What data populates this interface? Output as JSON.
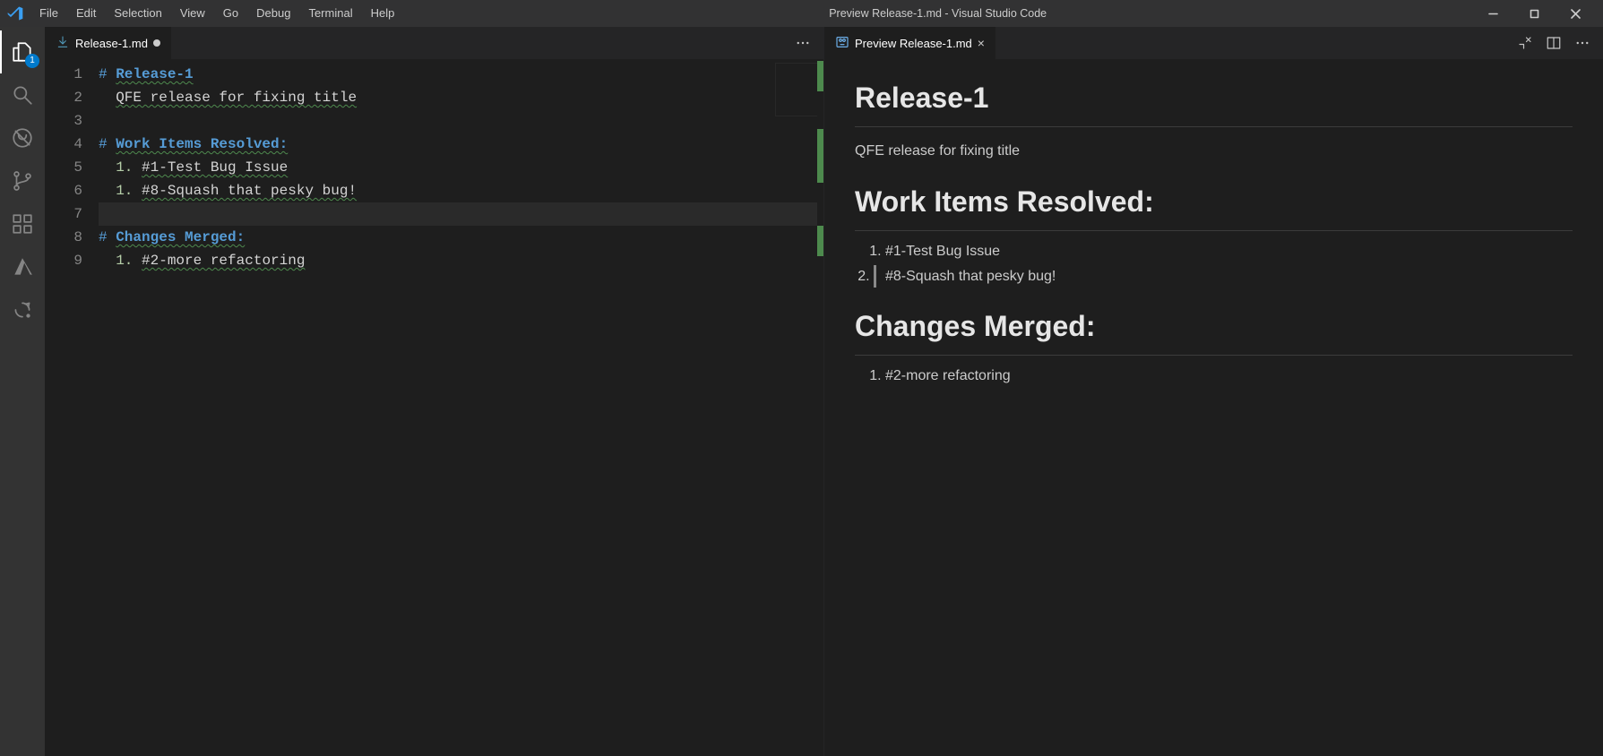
{
  "window": {
    "title": "Preview Release-1.md - Visual Studio Code"
  },
  "menu": {
    "items": [
      "File",
      "Edit",
      "Selection",
      "View",
      "Go",
      "Debug",
      "Terminal",
      "Help"
    ]
  },
  "activitybar": {
    "explorer_badge": "1"
  },
  "left_pane": {
    "tab": {
      "label": "Release-1.md",
      "icon": "markdown-download-icon",
      "dirty": true
    },
    "lines": [
      {
        "n": "1",
        "segments": [
          {
            "t": "# ",
            "c": "tok-hash"
          },
          {
            "t": "Release-1",
            "c": "tok-heading squiggle"
          }
        ]
      },
      {
        "n": "2",
        "segments": [
          {
            "t": "  ",
            "c": ""
          },
          {
            "t": "QFE release for fixing title",
            "c": "tok-plain squiggle"
          }
        ]
      },
      {
        "n": "3",
        "segments": []
      },
      {
        "n": "4",
        "segments": [
          {
            "t": "# ",
            "c": "tok-hash"
          },
          {
            "t": "Work Items Resolved:",
            "c": "tok-heading squiggle"
          }
        ]
      },
      {
        "n": "5",
        "segments": [
          {
            "t": "  ",
            "c": ""
          },
          {
            "t": "1. ",
            "c": "tok-listnum"
          },
          {
            "t": "#1-Test Bug Issue",
            "c": "tok-plain squiggle"
          }
        ]
      },
      {
        "n": "6",
        "segments": [
          {
            "t": "  ",
            "c": ""
          },
          {
            "t": "1. ",
            "c": "tok-listnum"
          },
          {
            "t": "#8-Squash that pesky bug!",
            "c": "tok-plain squiggle"
          }
        ]
      },
      {
        "n": "7",
        "segments": [],
        "current": true
      },
      {
        "n": "8",
        "segments": [
          {
            "t": "# ",
            "c": "tok-hash"
          },
          {
            "t": "Changes Merged:",
            "c": "tok-heading squiggle"
          }
        ]
      },
      {
        "n": "9",
        "segments": [
          {
            "t": "  ",
            "c": ""
          },
          {
            "t": "1. ",
            "c": "tok-listnum"
          },
          {
            "t": "#2-more refactoring",
            "c": "tok-plain squiggle"
          }
        ]
      }
    ]
  },
  "right_pane": {
    "tab": {
      "label": "Preview Release-1.md",
      "icon": "preview-icon",
      "closable": true
    },
    "preview": {
      "h1_0": "Release-1",
      "p_0": "QFE release for fixing title",
      "h1_1": "Work Items Resolved:",
      "ol_0": [
        "#1-Test Bug Issue",
        "#8-Squash that pesky bug!"
      ],
      "h1_2": "Changes Merged:",
      "ol_1": [
        "#2-more refactoring"
      ]
    }
  }
}
